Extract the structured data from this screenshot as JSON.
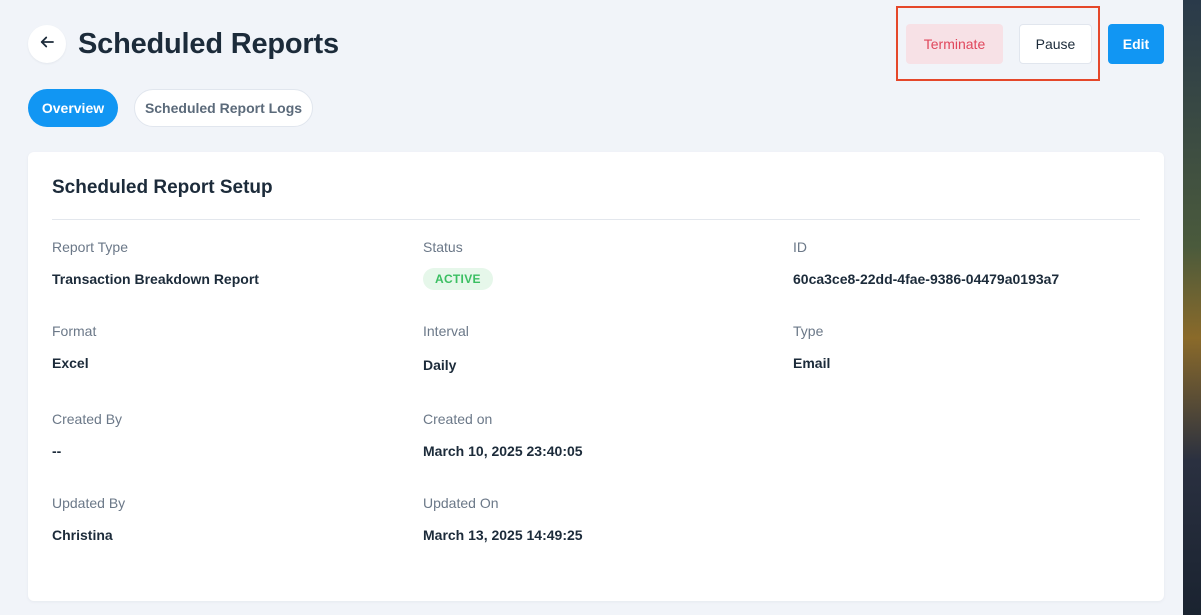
{
  "header": {
    "title": "Scheduled Reports",
    "buttons": {
      "terminate": "Terminate",
      "pause": "Pause",
      "edit": "Edit"
    }
  },
  "tabs": [
    {
      "label": "Overview",
      "active": true
    },
    {
      "label": "Scheduled Report Logs",
      "active": false
    }
  ],
  "card": {
    "title": "Scheduled Report Setup",
    "fields": {
      "report_type": {
        "label": "Report Type",
        "value": "Transaction Breakdown Report"
      },
      "status": {
        "label": "Status",
        "value": "ACTIVE"
      },
      "id": {
        "label": "ID",
        "value": "60ca3ce8-22dd-4fae-9386-04479a0193a7"
      },
      "format": {
        "label": "Format",
        "value": "Excel"
      },
      "interval": {
        "label": "Interval",
        "value": "Daily"
      },
      "type": {
        "label": "Type",
        "value": "Email"
      },
      "created_by": {
        "label": "Created By",
        "value": "--"
      },
      "created_on": {
        "label": "Created on",
        "value": "March 10, 2025 23:40:05"
      },
      "updated_by": {
        "label": "Updated By",
        "value": "Christina"
      },
      "updated_on": {
        "label": "Updated On",
        "value": "March 13, 2025 14:49:25"
      }
    }
  },
  "colors": {
    "accent": "#1196f3",
    "danger_text": "#e0475c",
    "danger_bg": "#f7e1e6",
    "success_text": "#3bbf62",
    "success_bg": "#e6f7ea",
    "highlight": "#e5472a"
  },
  "icons": {
    "back": "arrow-left-icon"
  }
}
